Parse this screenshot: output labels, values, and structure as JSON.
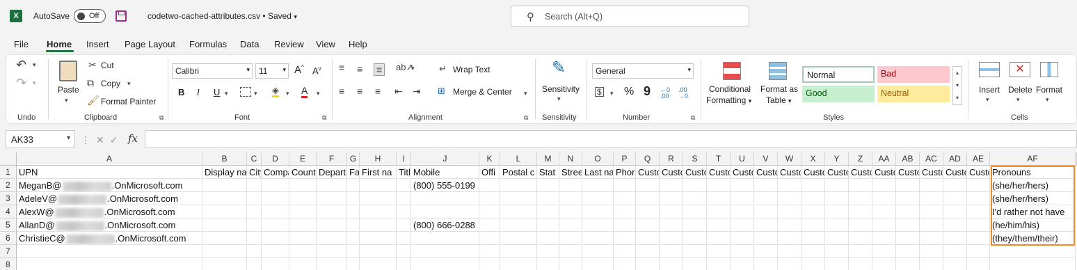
{
  "titlebar": {
    "app_logo": "X",
    "autosave_label": "AutoSave",
    "autosave_state": "Off",
    "file_title": "codetwo-cached-attributes.csv • Saved",
    "search_placeholder": "Search (Alt+Q)"
  },
  "menu": [
    "File",
    "Home",
    "Insert",
    "Page Layout",
    "Formulas",
    "Data",
    "Review",
    "View",
    "Help"
  ],
  "menu_active": "Home",
  "ribbon": {
    "undo_group": "Undo",
    "clipboard": {
      "paste": "Paste",
      "cut": "Cut",
      "copy": "Copy",
      "format_painter": "Format Painter",
      "label": "Clipboard"
    },
    "font": {
      "family": "Calibri",
      "size": "11",
      "grow": "A",
      "shrink": "A",
      "bold": "B",
      "italic": "I",
      "underline": "U",
      "font_color": "A",
      "label": "Font"
    },
    "alignment": {
      "wrap_text": "Wrap Text",
      "merge_center": "Merge & Center",
      "label": "Alignment"
    },
    "sensitivity": {
      "button": "Sensitivity",
      "label": "Sensitivity"
    },
    "number": {
      "format": "General",
      "percent": "%",
      "comma": "9",
      "inc_dec": "←0 .00",
      "dec_dec": ".00 →0",
      "label": "Number"
    },
    "styles": {
      "conditional_1": "Conditional",
      "conditional_2": "Formatting",
      "format_table_1": "Format as",
      "format_table_2": "Table",
      "normal": "Normal",
      "bad": "Bad",
      "good": "Good",
      "neutral": "Neutral",
      "label": "Styles",
      "colors": {
        "bad_bg": "#ffc7ce",
        "bad_fg": "#9c0006",
        "good_bg": "#c6efce",
        "good_fg": "#006100",
        "neutral_bg": "#ffeb9c",
        "neutral_fg": "#9c5700"
      }
    },
    "cells": {
      "insert": "Insert",
      "delete": "Delete",
      "format": "Format",
      "label": "Cells"
    }
  },
  "formula_bar": {
    "name_box": "AK33",
    "fx": "fx",
    "value": ""
  },
  "columns": [
    "A",
    "B",
    "C",
    "D",
    "E",
    "F",
    "G",
    "H",
    "I",
    "J",
    "K",
    "L",
    "M",
    "N",
    "O",
    "P",
    "Q",
    "R",
    "S",
    "T",
    "U",
    "V",
    "W",
    "X",
    "Y",
    "Z",
    "AA",
    "AB",
    "AC",
    "AD",
    "AE",
    "AF"
  ],
  "rows": [
    "1",
    "2",
    "3",
    "4",
    "5",
    "6",
    "7",
    "8"
  ],
  "header_row": [
    "UPN",
    "Display na",
    "City",
    "Compa",
    "Count",
    "Departn",
    "Fa:",
    "First na",
    "Titl",
    "Mobile",
    "Offi",
    "Postal c",
    "Stat",
    "Stree",
    "Last na",
    "Phor",
    "Custo",
    "Custo",
    "Custo",
    "Custo",
    "Custo",
    "Custo",
    "Custo",
    "Custo",
    "Custo",
    "Custo",
    "Custo",
    "Custo",
    "Custo",
    "Custo",
    "Custo",
    "Pronouns"
  ],
  "data_rows": [
    {
      "upn_prefix": "MeganB@",
      "upn_suffix": ".OnMicrosoft.com",
      "mobile": "(800) 555-0199",
      "pronouns": "(she/her/hers)"
    },
    {
      "upn_prefix": "AdeleV@",
      "upn_suffix": ".OnMicrosoft.com",
      "mobile": "",
      "pronouns": "(she/her/hers)"
    },
    {
      "upn_prefix": "AlexW@",
      "upn_suffix": ".OnMicrosoft.com",
      "mobile": "",
      "pronouns": "I'd rather not have"
    },
    {
      "upn_prefix": "AllanD@",
      "upn_suffix": ".OnMicrosoft.com",
      "mobile": "(800) 666-0288",
      "pronouns": "(he/him/his)"
    },
    {
      "upn_prefix": "ChristieC@",
      "upn_suffix": ".OnMicrosoft.com",
      "mobile": "",
      "pronouns": "(they/them/their)"
    }
  ],
  "accent_color": "#217346",
  "highlight_color": "#f08c28"
}
